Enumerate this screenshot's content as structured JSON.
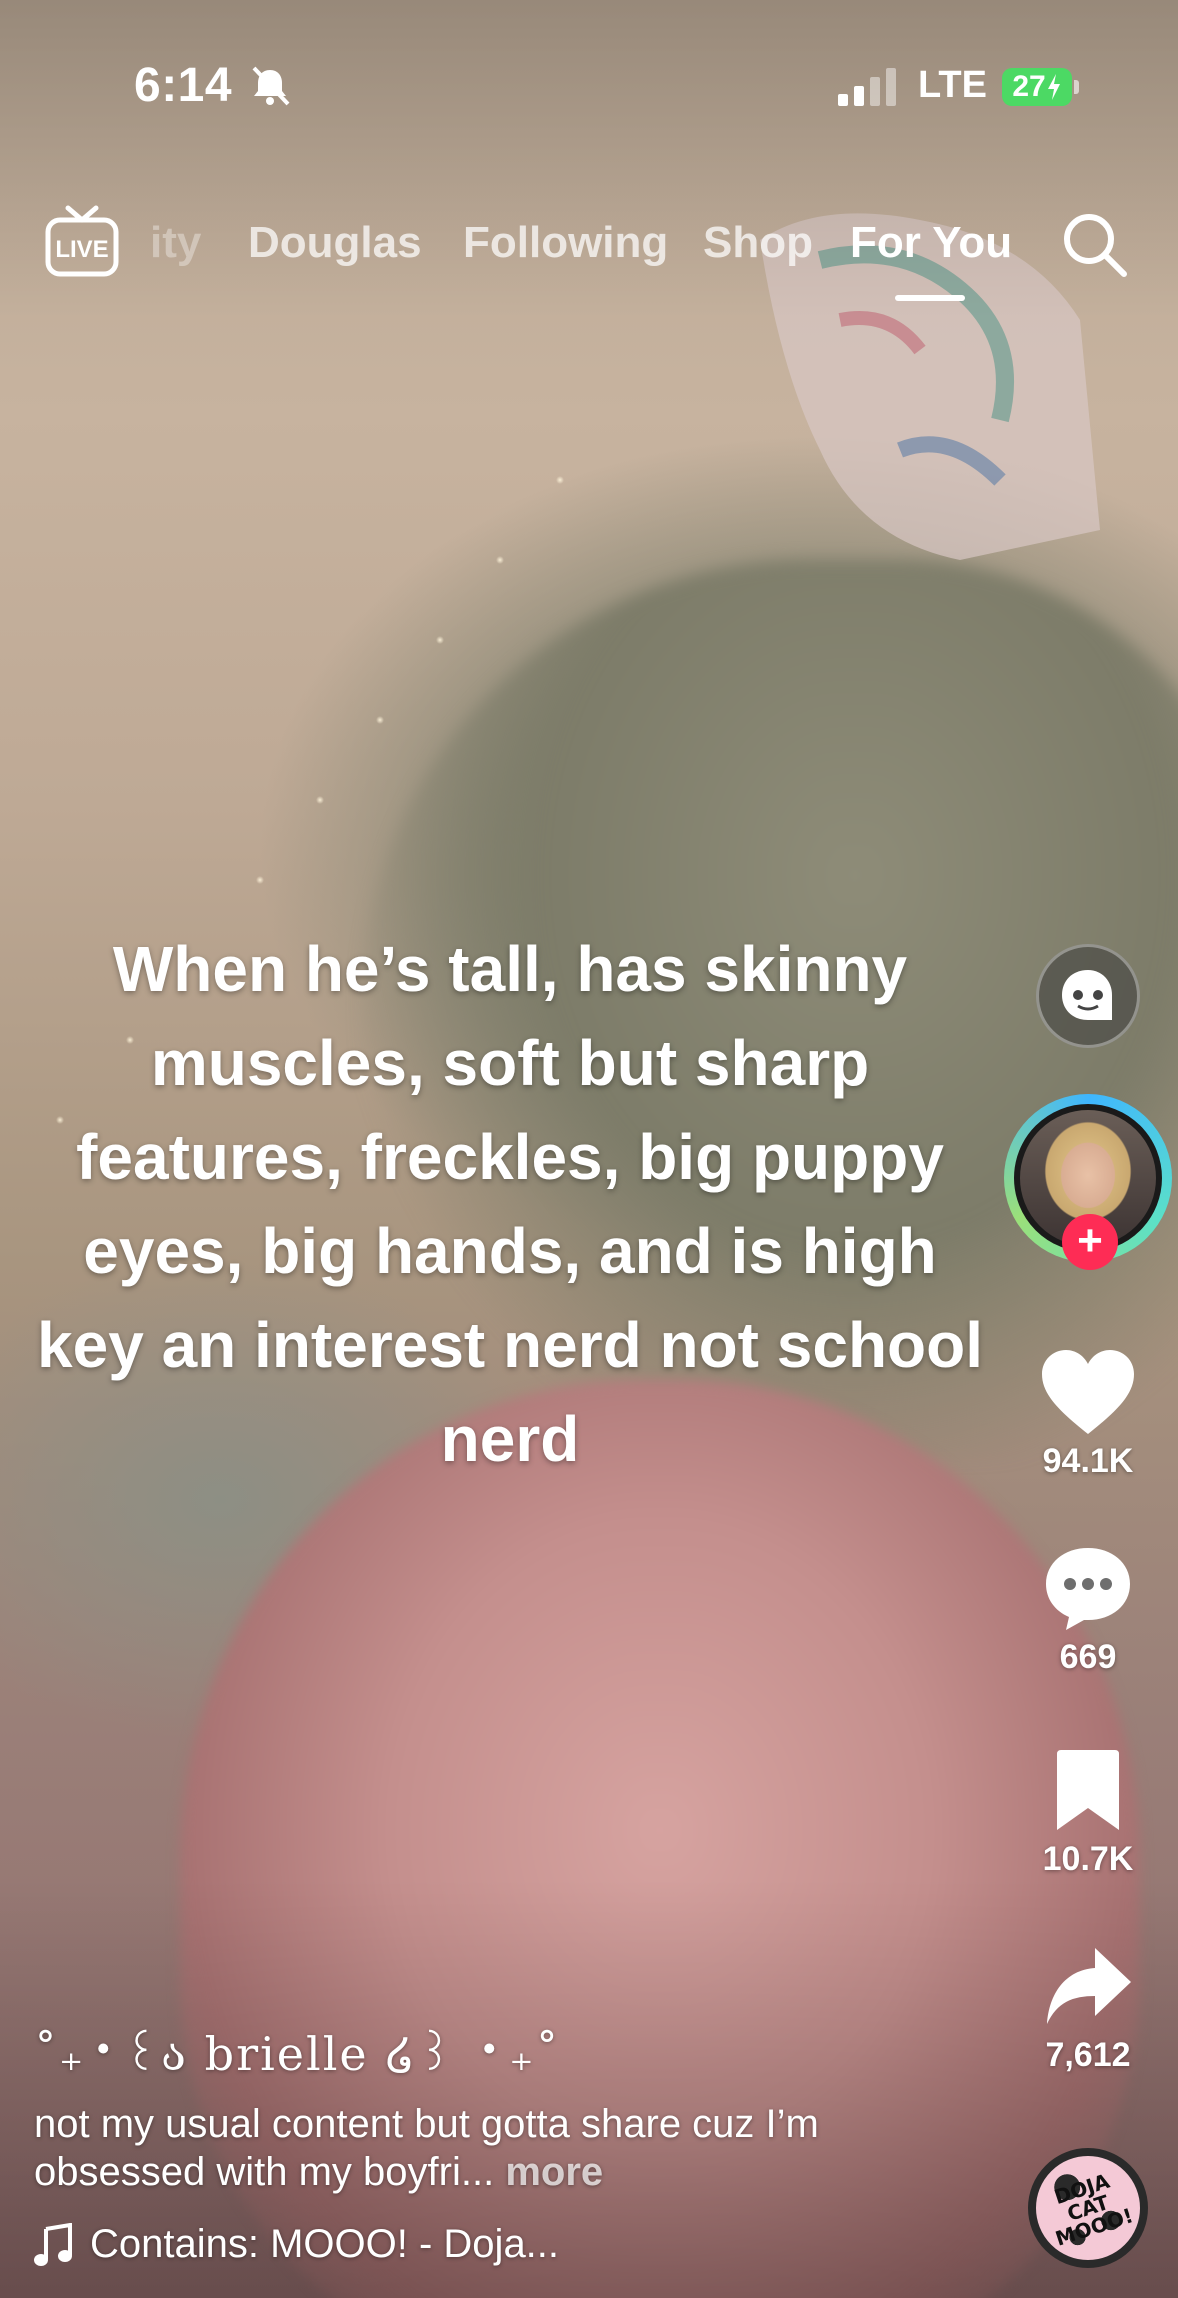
{
  "status_bar": {
    "time": "6:14",
    "carrier": "LTE",
    "battery": "27",
    "icons": [
      "bell-slash-icon",
      "signal-icon",
      "battery-charging-icon"
    ]
  },
  "top_nav": {
    "live_label": "LIVE",
    "tabs": [
      {
        "label": "ity",
        "state": "faded"
      },
      {
        "label": "Douglas",
        "state": "inactive"
      },
      {
        "label": "Following",
        "state": "inactive"
      },
      {
        "label": "Shop",
        "state": "inactive"
      },
      {
        "label": "For You",
        "state": "active"
      }
    ],
    "search_icon": "search-icon"
  },
  "video": {
    "caption": "When he’s tall, has skinny muscles, soft but sharp features, freckles, big puppy eyes, big hands, and is high key an interest nerd not school nerd"
  },
  "right_rail": {
    "likes": "94.1K",
    "comments": "669",
    "saves": "10.7K",
    "shares": "7,612",
    "follow_symbol": "+",
    "music_disc_label": "DOJA CAT MOOO!"
  },
  "post": {
    "username": "˚₊‧꒰ა brielle ໒꒱ ‧₊˚",
    "description": "not my usual content but gotta share cuz I’m obsessed with my boyfri...",
    "more_label": "more",
    "sound": "Contains: MOOO! - Doja..."
  },
  "colors": {
    "accent": "#fe2c55",
    "battery": "#4cd964",
    "text": "#ffffff"
  }
}
